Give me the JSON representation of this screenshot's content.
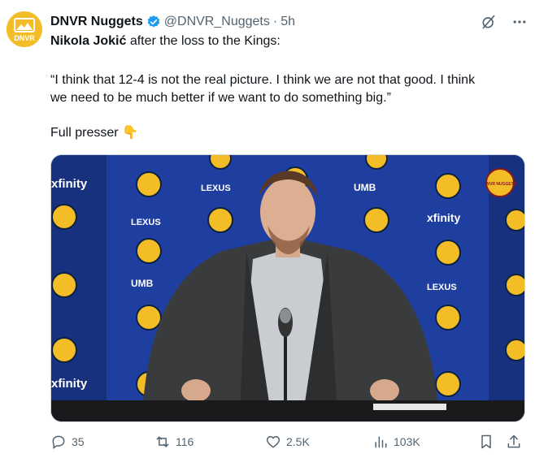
{
  "tweet": {
    "author_name": "DNVR Nuggets",
    "handle": "@DNVR_Nuggets",
    "separator": "·",
    "time": "5h",
    "avatar_text": "DNVR",
    "line1_bold": "Nikola Jokić",
    "line1_rest": " after the loss to the Kings:",
    "quote_line1": "“I think that 12-4 is not the real picture. I think we are not that good. I think",
    "quote_line2": "we need to be much better if we want to do something big.”",
    "footer_text": "Full presser",
    "footer_emoji": "👇"
  },
  "media": {
    "backdrop_words": [
      "xfinity",
      "LEXUS",
      "UMB",
      "xfinity",
      "LEXUS",
      "UMB",
      "xfinity",
      "LEXUS"
    ],
    "watermark_text": "DNVR NUGGETS"
  },
  "actions": {
    "replies": "35",
    "reposts": "116",
    "likes": "2.5K",
    "views": "103K"
  },
  "colors": {
    "accent": "#1d9bf0",
    "muted": "#536471",
    "backdrop": "#1f3fa0",
    "jacket": "#3a3b3d"
  }
}
